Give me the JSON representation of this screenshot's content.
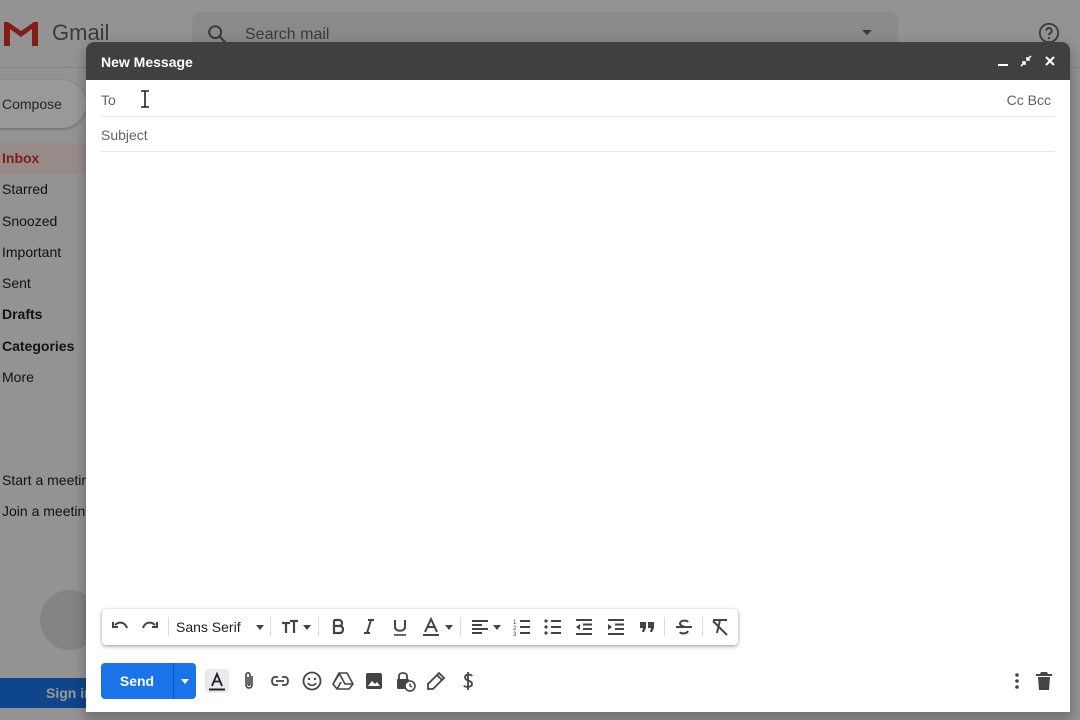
{
  "gmail": {
    "logo_text": "Gmail",
    "search_placeholder": "Search mail",
    "compose_label": "Compose",
    "nav": [
      {
        "label": "Inbox"
      },
      {
        "label": "Starred"
      },
      {
        "label": "Snoozed"
      },
      {
        "label": "Important"
      },
      {
        "label": "Sent"
      },
      {
        "label": "Drafts"
      },
      {
        "label": "Categories"
      },
      {
        "label": "More"
      }
    ],
    "meet": [
      "Start a meeting",
      "Join a meeting"
    ],
    "signin_label": "Sign in"
  },
  "compose": {
    "title": "New Message",
    "to_label": "To",
    "cc_bcc_label": "Cc Bcc",
    "subject_placeholder": "Subject",
    "font_name": "Sans Serif",
    "send_label": "Send"
  },
  "colors": {
    "accent": "#1a73e8",
    "header": "#404040",
    "inbox_active": "#d93025"
  }
}
